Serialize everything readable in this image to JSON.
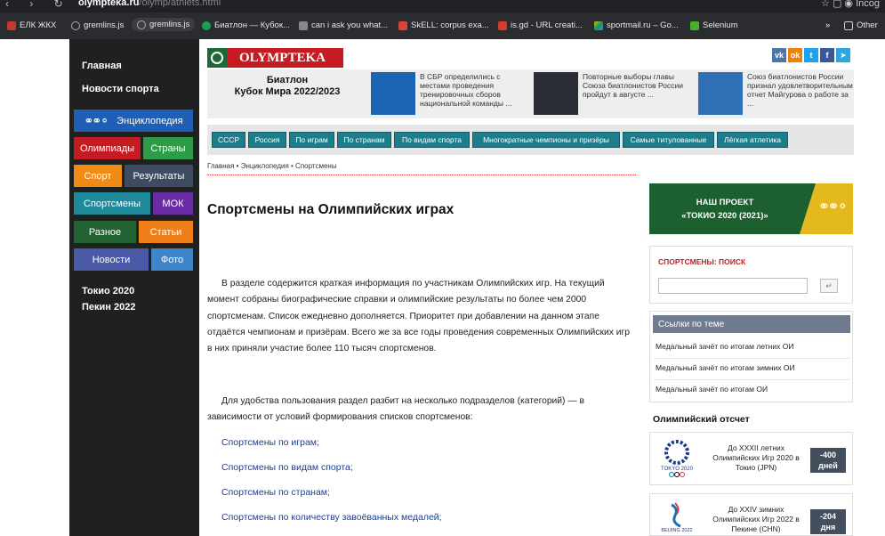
{
  "browser": {
    "url_domain": "olympteka.ru",
    "url_path": "/olymp/athlets.html",
    "profile_label": "Incog",
    "bookmarks": [
      {
        "label": "ЕЛК ЖКХ"
      },
      {
        "label": "gremlins.js"
      },
      {
        "label": "gremlins.js"
      },
      {
        "label": "Биатлон — Кубок..."
      },
      {
        "label": "can i ask you what..."
      },
      {
        "label": "SkELL: corpus exa..."
      },
      {
        "label": "is.gd - URL creati..."
      },
      {
        "label": "sportmail.ru – Go..."
      },
      {
        "label": "Selenium"
      }
    ],
    "more_label": "»",
    "other_label": "Other"
  },
  "sidebar": {
    "links": [
      "Главная",
      "Новости спорта"
    ],
    "buttons": {
      "encyclopedia": "Энциклопедия",
      "olympiads": "Олимпиады",
      "countries": "Страны",
      "sport": "Спорт",
      "results": "Результаты",
      "athletes": "Спортсмены",
      "ioc": "МОК",
      "misc": "Разное",
      "articles": "Статьи",
      "news": "Новости",
      "photo": "Фото"
    },
    "games": [
      "Токио 2020",
      "Пекин 2022"
    ]
  },
  "header": {
    "logo": "OLYMPTEKA",
    "social": [
      "vk",
      "ok",
      "tw",
      "fb",
      "tg"
    ]
  },
  "news_strip": {
    "title_line1": "Биатлон",
    "title_line2": "Кубок Мира 2022/2023",
    "items": [
      "В СБР определились с местами проведения тренировочных сборов национальной команды ...",
      "Повторные выборы главы Союза биатлонистов России пройдут в августе ...",
      "Союз биатлонистов России признал удовлетворительным отчет Майгурова о работе за ..."
    ]
  },
  "categories": [
    "СССР",
    "Россия",
    "По играм",
    "По странам",
    "По видам спорта",
    "Многократные чемпионы и призёры",
    "Самые титулованные",
    "Лёгкая атлетика"
  ],
  "breadcrumbs": {
    "home": "Главная",
    "mid": "Энциклопедия",
    "current": "Спортсмены"
  },
  "main": {
    "title": "Спортсмены на Олимпийских играх",
    "para1": "В разделе содержится краткая информация по участникам Олимпийских игр. На текущий момент собраны биографические справки и олимпийские результаты по более чем 2000 спортсменам. Список ежедневно дополняется. Приоритет при добавлении на данном этапе отдаётся чемпионам и призёрам. Всего же за все годы проведения современных Олимпийских игр в них приняли участие более 110 тысяч спортсменов.",
    "para2": "Для удобства пользования раздел разбит на несколько подразделов (категорий) — в зависимости от условий формирования списков спортсменов:",
    "toc": [
      "Спортсмены по играм;",
      "Спортсмены по видам спорта;",
      "Спортсмены по странам;",
      "Спортсмены по количеству завоёванных медалей;"
    ]
  },
  "right": {
    "promo_line1": "НАШ ПРОЕКТ",
    "promo_line2": "«ТОКИО 2020 (2021)»",
    "search_label_a": "СПОРТСМЕНЫ",
    "search_label_b": ": ПОИСК",
    "search_go": "↵",
    "links_title": "Ссылки по теме",
    "links": [
      "Медальный зачёт по итогам летних ОИ",
      "Медальный зачёт по итогам зимних ОИ",
      "Медальный зачёт по итогам ОИ"
    ],
    "countdown_title": "Олимпийский отсчет",
    "countdown": [
      {
        "text": "До XXXII летних Олимпийских Игр 2020 в Токио (JPN)",
        "days": "-400",
        "unit": "дней",
        "emblem": "TOKYO 2020"
      },
      {
        "text": "До XXIV зимних Олимпийских Игр 2022 в Пекине (CHN)",
        "days": "-204",
        "unit": "дня",
        "emblem": "BEIJING 2022"
      }
    ]
  },
  "colors": {
    "sidebar_bg": "#1f2120",
    "encyclopedia": "#1f5fb5",
    "olympiads": "#c41c22",
    "countries": "#2e9b46",
    "sport": "#f28a16",
    "results": "#3d4c61",
    "athletes": "#1e8a9c",
    "ioc": "#6a2da8",
    "misc": "#236332",
    "articles": "#ee7f1b",
    "news": "#4a5aa8",
    "photo": "#3f85c9",
    "category": "#1e7d8a",
    "logo_red": "#c41c22"
  }
}
